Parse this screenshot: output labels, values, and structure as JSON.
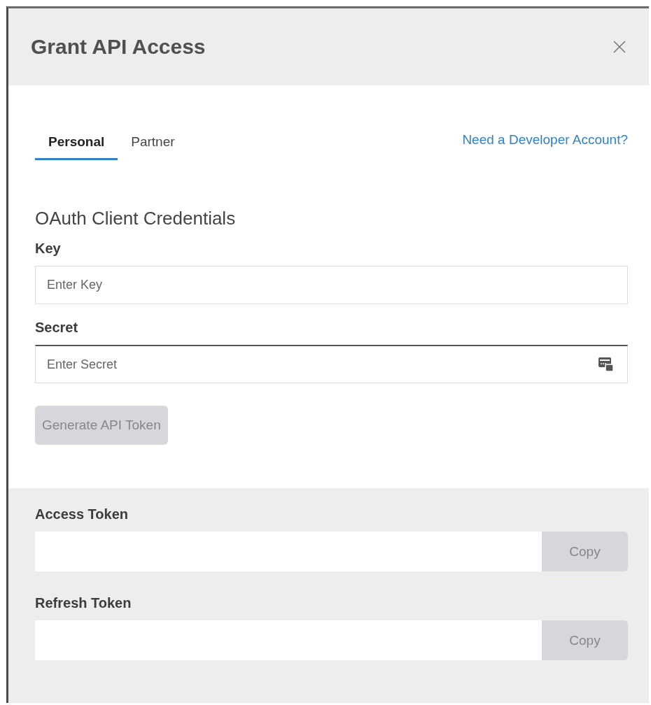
{
  "dialog": {
    "title": "Grant API Access"
  },
  "tabs": [
    {
      "label": "Personal",
      "selected": true
    },
    {
      "label": "Partner",
      "selected": false
    }
  ],
  "developer_link": "Need a Developer Account?",
  "section_title": "OAuth Client Credentials",
  "fields": [
    {
      "label": "Key",
      "placeholder": "Enter Key",
      "focused": false,
      "kind": "text"
    },
    {
      "label": "Secret",
      "placeholder": "Enter Secret",
      "focused": true,
      "kind": "secret"
    }
  ],
  "generate_button": {
    "label": "Generate API Token",
    "disabled": true
  },
  "tokens": [
    {
      "label": "Access Token",
      "button": "Copy",
      "disabled": true
    },
    {
      "label": "Refresh Token",
      "button": "Copy",
      "disabled": true
    }
  ]
}
